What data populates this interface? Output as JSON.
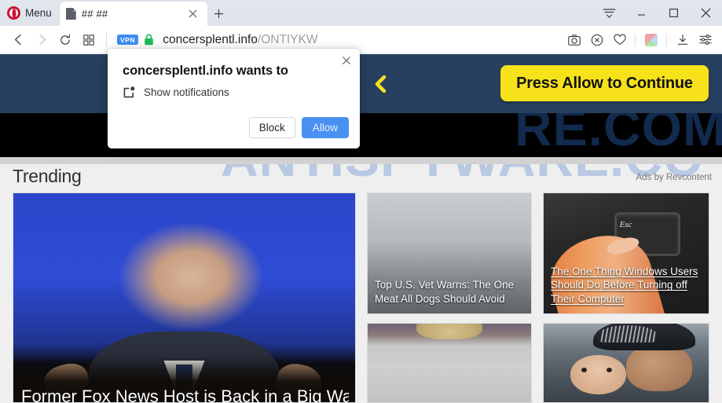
{
  "browser": {
    "menu_label": "Menu",
    "opera_logo_icon": "opera-logo-icon",
    "tab": {
      "title": "## ##",
      "favicon_icon": "page-favicon-icon",
      "close_icon": "tab-close-icon"
    },
    "new_tab_icon": "plus-icon",
    "window_controls": [
      {
        "name": "easy-setup-button",
        "icon": "sliders-down-icon"
      },
      {
        "name": "minimize-button",
        "icon": "minimize-icon"
      },
      {
        "name": "maximize-button",
        "icon": "maximize-icon"
      },
      {
        "name": "close-window-button",
        "icon": "close-icon"
      }
    ],
    "toolbar": {
      "back_icon": "chevron-left-icon",
      "forward_icon": "chevron-right-icon",
      "reload_icon": "reload-icon",
      "tiles_icon": "grid-tiles-icon",
      "vpn_badge": "VPN",
      "lock_icon": "padlock-icon",
      "url_host": "concersplentl.info",
      "url_path": "/ONTIYKW",
      "right_icons": [
        {
          "name": "snapshot-button",
          "icon": "camera-icon"
        },
        {
          "name": "ad-blocker-button",
          "icon": "shield-x-icon"
        },
        {
          "name": "favorites-button",
          "icon": "heart-icon"
        },
        {
          "name": "extension-button",
          "icon": "cube-icon"
        },
        {
          "name": "downloads-button",
          "icon": "download-icon"
        },
        {
          "name": "easy-setup-button",
          "icon": "sliders-icon"
        }
      ]
    }
  },
  "dialog": {
    "title": "concersplentl.info wants to",
    "permission_label": "Show notifications",
    "permission_icon": "notification-bell-icon",
    "close_icon": "close-icon",
    "block_label": "Block",
    "allow_label": "Allow",
    "accent_allow": "#4a90f0"
  },
  "page": {
    "banner": {
      "back_icon": "chevron-left-icon",
      "cta_label": "Press Allow to Continue",
      "cta_color": "#f7e11b",
      "banner_color": "#27405f"
    },
    "watermark_top": "RE.COM",
    "watermark_mid": "ANTISPYWARE.CO",
    "trending": {
      "heading": "Trending",
      "ads_by": "Ads by Revcontent"
    },
    "cards": [
      {
        "name": "hero-card",
        "title": "Former Fox News Host is Back in a Big Way",
        "image": "older-man-in-suit-blue-backdrop"
      },
      {
        "name": "ad-card-vet-warns",
        "title": "Top U.S. Vet Warns: The One Meat All Dogs Should Avoid",
        "image": "grey-gradient-dog-photo"
      },
      {
        "name": "ad-card-windows-esc",
        "title": "The One Thing Windows Users Should Do Before Turning off Their Computer",
        "image": "finger-pressing-esc-key"
      },
      {
        "name": "ad-card-blonde",
        "title": "",
        "image": "blonde-person-photo"
      },
      {
        "name": "ad-card-dad-baby",
        "title": "",
        "image": "man-in-cap-holding-baby"
      }
    ]
  }
}
